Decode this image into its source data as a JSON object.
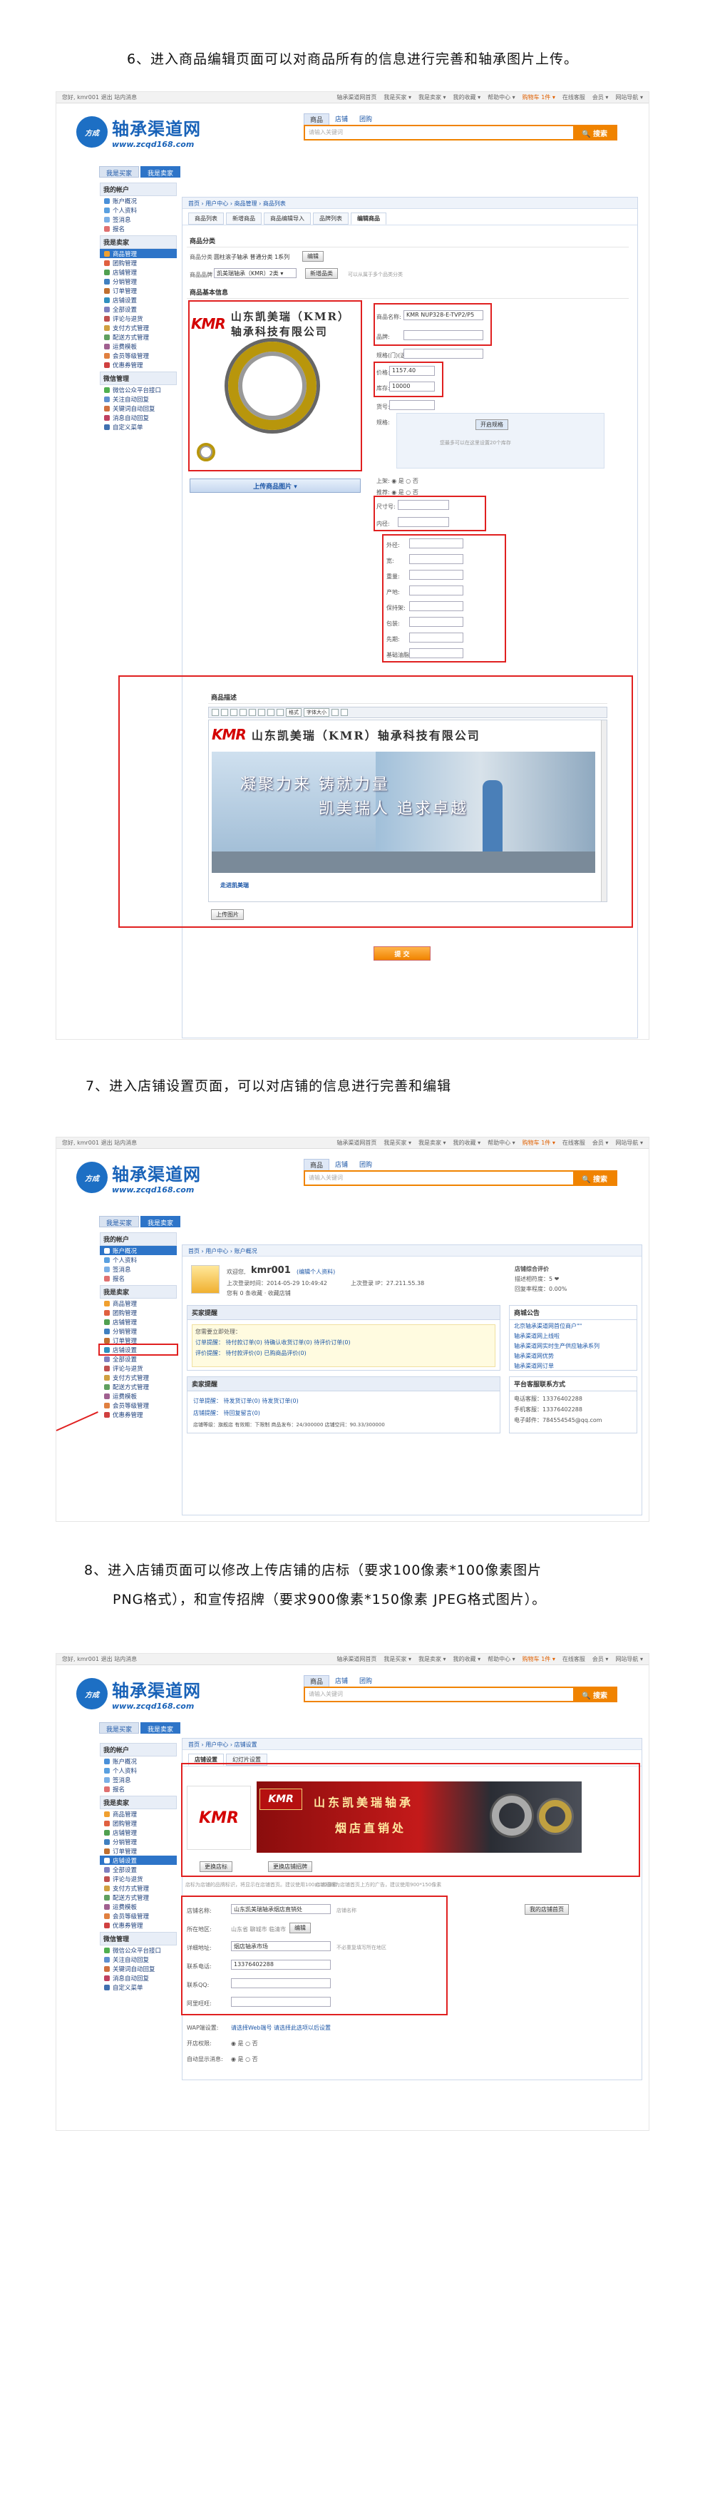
{
  "steps": {
    "s6": "6、进入商品编辑页面可以对商品所有的信息进行完善和轴承图片上传。",
    "s7": "7、进入店铺设置页面，可以对店铺的信息进行完善和编辑",
    "s8a": "8、进入店铺页面可以修改上传店铺的店标（要求100像素*100像素图片",
    "s8b": "PNG格式），和宣传招牌（要求900像素*150像素 JPEG格式图片）。"
  },
  "topbar": {
    "left": "您好, kmr001  退出  站内消息",
    "items": [
      "轴承渠道网首页",
      "我是买家 ▾",
      "我是卖家 ▾",
      "我的收藏 ▾",
      "帮助中心 ▾",
      "购物车 1件 ▾",
      "在线客服",
      "会员 ▾",
      "网站导航 ▾"
    ]
  },
  "logo": {
    "emblem": "方成",
    "title": "轴承渠道网",
    "url": "www.zcqd168.com"
  },
  "search": {
    "tabs": [
      "商品",
      "店铺",
      "团购"
    ],
    "placeholder": "请输入关键词",
    "button": "🔍 搜索"
  },
  "nav": {
    "buyer": "我是买家",
    "seller": "我是卖家"
  },
  "sidebar": {
    "g1": "我的帐户",
    "g1_items": [
      "账户概况",
      "个人资料",
      "签消息",
      "报名"
    ],
    "g2": "我是卖家",
    "g2_items": [
      "商品管理",
      "团购管理",
      "店铺管理",
      "分销管理",
      "订单管理",
      "店铺设置",
      "全部设置",
      "评论与退货",
      "支付方式管理",
      "配送方式管理",
      "运费模板",
      "会员等级管理",
      "优惠券管理"
    ],
    "g3": "微信管理",
    "g3_items": [
      "微信公众平台接口",
      "关注自动回复",
      "关键词自动回复",
      "消息自动回复",
      "自定义菜单"
    ]
  },
  "screen1": {
    "crumb": "首页 › 用户中心 › 商品管理 › 商品列表",
    "tabs": [
      "商品列表",
      "新增商品",
      "商品编辑导入",
      "品牌列表",
      "编辑商品"
    ],
    "cat_title": "商品分类",
    "cat_label": "商品分类",
    "cat_value": "圆柱滚子轴承 普通分类 1系列",
    "cat_edit": "编辑",
    "brand_label": "商品品牌",
    "brand_value": "凯美瑞轴承（KMR）2类 ▾",
    "brand_btn": "新增品类",
    "brand_hint": "可以从属于多个品类分类",
    "info_title": "商品基本信息",
    "fields": [
      {
        "label": "商品名称:",
        "value": "KMR NUP328-E-TVP2/P5"
      },
      {
        "label": "品牌:",
        "value": ""
      },
      {
        "label": "规格(门)(选):",
        "value": ""
      },
      {
        "label": "价格:",
        "value": "1157.40"
      },
      {
        "label": "库存:",
        "value": "10000"
      },
      {
        "label": "货号:",
        "value": ""
      },
      {
        "label": "规格:",
        "value": ""
      }
    ],
    "spec_btn": "开启规格",
    "spec_hint": "您最多可以在这里设置20个库存",
    "onsale": "上架: ◉ 是 ○ 否",
    "recommend": "推荐: ◉ 是 ○ 否",
    "attrs": [
      "尺寸号:",
      "内径:",
      "外径:",
      "宽:",
      "重量:",
      "产地:",
      "保持架:",
      "包装:",
      "先期:",
      "基础油脂:"
    ],
    "upload_img": "上传商品图片 ▾",
    "desc_title": "商品描述",
    "toolbar": [
      "格式",
      "字体大小"
    ],
    "banner_company": "山东凯美瑞（KMR）轴承科技有限公司",
    "banner_slogan1": "凝聚力来  铸就力量",
    "banner_slogan2": "凯美瑞人  追求卓越",
    "banner_link": "走进凯美瑞",
    "upload_btn": "上传图片",
    "submit": "提 交"
  },
  "screen2": {
    "crumb": "首页 › 用户中心 › 账户概况",
    "username": "kmr001",
    "welcome": "欢迎您,",
    "member_link": "(编辑个人资料)",
    "last_login": "上次登录时间：2014-05-29 10:49:42",
    "last_ip": "上次登录 IP：27.211.55.38",
    "fav_shop": "您有 0 条收藏 · 收藏店铺",
    "credit": "店铺综合评价",
    "credit_a": "描述相符度：5 ❤",
    "credit_b": "回复率程度：0.00%",
    "buyer_title": "买家提醒",
    "buyer_reminder": "您需要立即处理：",
    "buyer_rows": [
      "订单提醒：  待付款订单(0)    待确认收货订单(0)    待评价订单(0)",
      "评价提醒：  待付款评价(0)    已购商品评价(0)"
    ],
    "seller_title": "卖家提醒",
    "seller_rows": [
      "订单提醒：  待发货订单(0)      待发货订单(0)",
      "店铺提醒：  待回复留言(0)"
    ],
    "shop_info": "店铺等级：旗舰店  有效期：下限制  商品发布：24/300000  店铺空间：90.33/300000",
    "notice_title": "商城公告",
    "notices": [
      "北京轴承渠道网首位商户\"\"",
      "轴承渠道网上线啦",
      "轴承渠道网实时生产供应轴承系列",
      "轴承渠道网优势",
      "轴承渠道网订单"
    ],
    "service_title": "平台客服联系方式",
    "service_rows": [
      "电话客服：13376402288",
      "手机客服：13376402288",
      "电子邮件：784554545@qq.com"
    ]
  },
  "screen3": {
    "crumb": "首页 › 用户中心 › 店铺设置",
    "tabs": [
      "店铺设置",
      "幻灯片设置"
    ],
    "banner_cn1": "山东凯美瑞轴承",
    "banner_cn2": "烟店直销处",
    "btn_logo": "更换店标",
    "btn_banner": "更换店铺招牌",
    "logo_hint": "店标为店铺的品牌标识，将显示在店铺首页。建议使用100x100像素",
    "banner_hint": "店铺招牌为店铺首页上方的广告，建议使用900*150像素",
    "fields": [
      {
        "label": "店铺名称:",
        "value": "山东凯美瑞轴承烟店直销处"
      },
      {
        "label": "所在地区:",
        "value": "山东省 聊城市 临清市"
      },
      {
        "label": "详细地址:",
        "value": "烟店轴承市场"
      },
      {
        "label": "联系电话:",
        "value": "13376402288"
      },
      {
        "label": "联系QQ:",
        "value": ""
      },
      {
        "label": "阿里旺旺:",
        "value": ""
      }
    ],
    "area_edit": "编辑",
    "my_shop": "我的店铺首页",
    "name_hint": "店铺名称",
    "addr_hint": "不必重复填写所在地区",
    "wap_label": "WAP端设置:",
    "wap_value": "请选择Web端号  请选择此选项以后设置",
    "status_label": "开店权限:",
    "status_value": "◉ 是 ○ 否",
    "msg_label": "自动显示消息:",
    "msg_value": "◉ 是 ○ 否"
  }
}
